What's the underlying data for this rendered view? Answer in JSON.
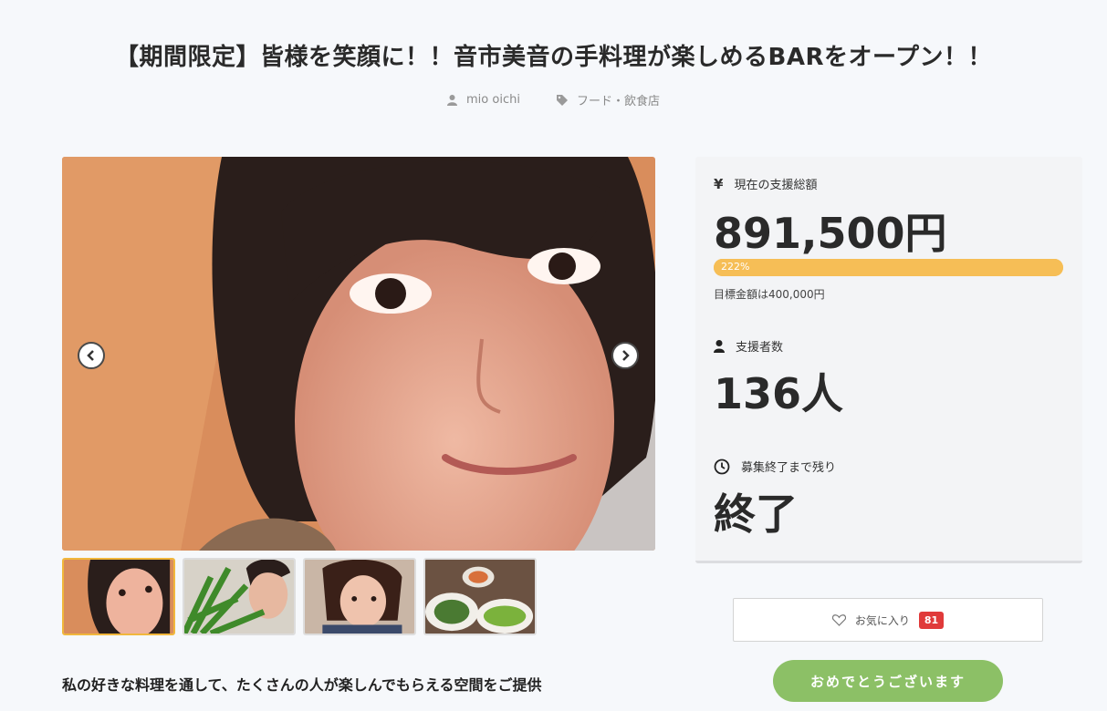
{
  "project": {
    "title": "【期間限定】皆様を笑顔に！！音市美音の手料理が楽しめるBARをオープン！！",
    "author": "mio oichi",
    "category": "フード・飲食店",
    "subtitle": "私の好きな料理を通して、たくさんの人が楽しんでもらえる空間をご提供"
  },
  "gallery": {
    "prev_icon": "chevron-left-icon",
    "next_icon": "chevron-right-icon",
    "thumbnails": [
      {
        "desc": "portrait-woman"
      },
      {
        "desc": "green-plant-woman"
      },
      {
        "desc": "woman-short-hair"
      },
      {
        "desc": "plated-dishes"
      }
    ]
  },
  "stats": {
    "total_label": "現在の支援総額",
    "total_value": "891,500円",
    "progress_text": "222%",
    "progress_percent": 100,
    "goal_text": "目標金額は400,000円",
    "supporters_label": "支援者数",
    "supporters_value": "136人",
    "remaining_label": "募集終了まで残り",
    "remaining_value": "終了"
  },
  "actions": {
    "favorite_label": "お気に入り",
    "favorite_count": "81",
    "congrats_label": "おめでとうございます"
  },
  "colors": {
    "progress": "#f6be56",
    "favorite_badge": "#e03a3a",
    "congrats_button": "#8cc066",
    "active_thumb_border": "#f1b73c"
  }
}
